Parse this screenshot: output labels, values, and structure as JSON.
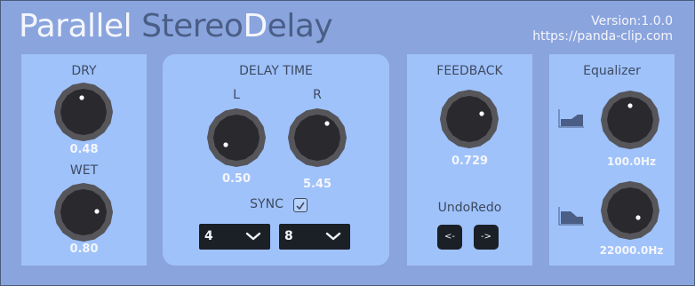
{
  "header": {
    "title_word1": "Parallel",
    "title_word2": "Stereo",
    "title_word3": "D",
    "title_word4": "elay",
    "version": "Version:1.0.0",
    "url": "https://panda-clip.com"
  },
  "dry_wet": {
    "dry_label": "DRY",
    "dry_value": "0.48",
    "wet_label": "WET",
    "wet_value": "0.80"
  },
  "delay": {
    "label": "DELAY TIME",
    "left_label": "L",
    "right_label": "R",
    "left_value": "0.50",
    "right_value": "5.45",
    "sync_label": "SYNC",
    "sync_checked": true,
    "left_select": "4",
    "right_select": "8"
  },
  "feedback": {
    "label": "FEEDBACK",
    "value": "0.729",
    "undoredo_label": "UndoRedo",
    "undo_label": "<-",
    "redo_label": "->"
  },
  "equalizer": {
    "label": "Equalizer",
    "low_value": "100.0Hz",
    "high_value": "22000.0Hz"
  },
  "colors": {
    "background": "#8aa4de",
    "panel": "#9fc2fb",
    "knob_outer": "#55555a",
    "knob_inner": "#2a2a2e",
    "control_dark": "#1b1f26"
  },
  "icons": {
    "knob": "knob-icon",
    "dropdown": "chevron-down-icon",
    "checkbox": "check-icon",
    "low_shelf": "low-shelf-filter-icon",
    "high_shelf": "high-shelf-filter-icon"
  }
}
